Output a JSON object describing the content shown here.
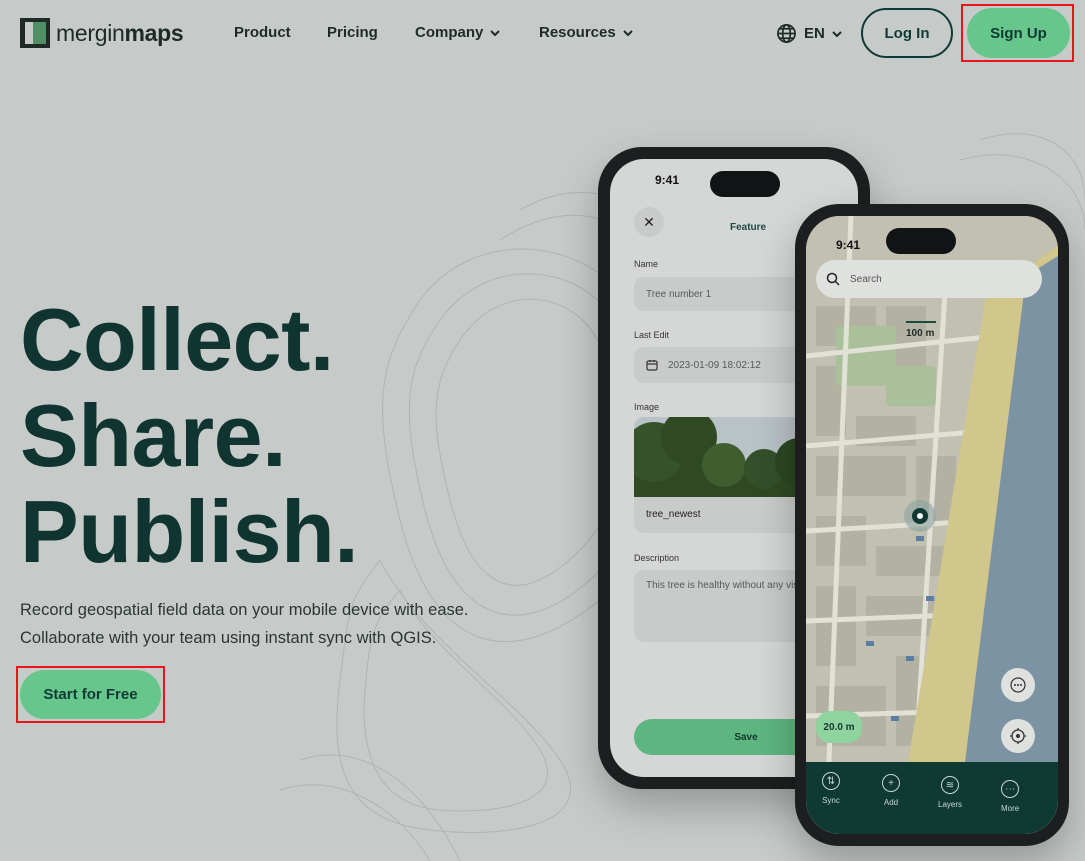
{
  "header": {
    "logo": {
      "part1": "mergin",
      "part2": "maps"
    },
    "nav": [
      {
        "label": "Product"
      },
      {
        "label": "Pricing"
      },
      {
        "label": "Company"
      },
      {
        "label": "Resources"
      }
    ],
    "language": "EN",
    "login_label": "Log In",
    "signup_label": "Sign Up"
  },
  "hero": {
    "title_lines": [
      "Collect.",
      "Share.",
      "Publish."
    ],
    "subtitle_lines": [
      "Record geospatial field data on your mobile device with ease.",
      "Collaborate with your team using instant sync with QGIS."
    ],
    "cta_label": "Start for Free"
  },
  "phone_form": {
    "time": "9:41",
    "title": "Feature",
    "fields": [
      {
        "label": "Name",
        "value": "Tree number 1"
      },
      {
        "label": "Last Edit",
        "value": "2023-01-09 18:02:12"
      },
      {
        "label": "Image",
        "caption": "tree_newest"
      },
      {
        "label": "Description",
        "value": "This tree is healthy without any visu"
      }
    ],
    "save_label": "Save"
  },
  "phone_map": {
    "time": "9:41",
    "search_placeholder": "Search",
    "scale_label": "100 m",
    "accuracy_label": "20.0 m",
    "tabs": [
      {
        "label": "Sync",
        "icon": "sync-icon"
      },
      {
        "label": "Add",
        "icon": "plus-icon"
      },
      {
        "label": "Layers",
        "icon": "layers-icon"
      },
      {
        "label": "More",
        "icon": "more-icon"
      }
    ]
  },
  "colors": {
    "brand_green": "#67c68c",
    "dark_green": "#0f3a34",
    "background": "#c6cbc9",
    "highlight": "#e8161c"
  }
}
